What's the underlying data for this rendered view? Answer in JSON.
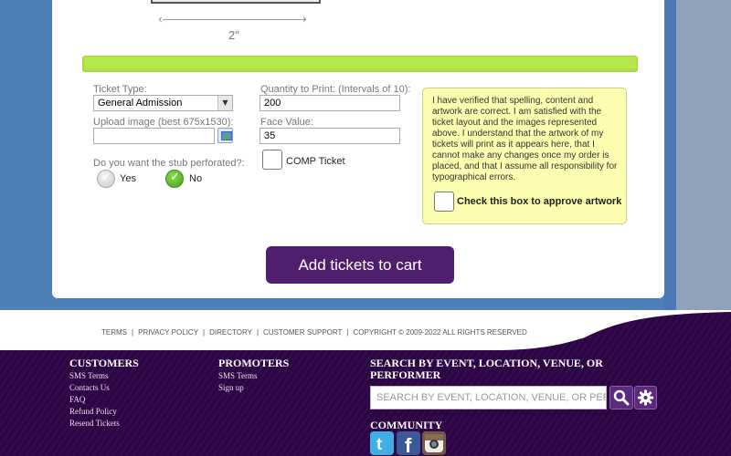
{
  "preview": {
    "width_label": "2\""
  },
  "form": {
    "ticket_type_label": "Ticket Type:",
    "ticket_type_value": "General Admission",
    "quantity_label": "Quantity to Print: (Intervals of 10):",
    "quantity_value": "200",
    "upload_label": "Upload image (best 675x1530):",
    "upload_value": "",
    "face_value_label": "Face Value:",
    "face_value_value": "35",
    "perforated_label": "Do you want the stub perforated?:",
    "perforated_options": [
      {
        "label": "Yes",
        "selected": false
      },
      {
        "label": "No",
        "selected": true
      }
    ],
    "comp_label": "COMP Ticket",
    "comp_checked": false
  },
  "approval": {
    "text": "I have verified that spelling, content and artwork are correct. I am satisfied with the ticket layout and the images represented above. I understand that the artwork of my tickets will print as it appears here, that I cannot make any changes once my order is placed, and that I assume all responsibility for typographical errors.",
    "checkbox_label": "Check this box to approve artwork",
    "checked": false
  },
  "cart_button": "Add tickets to cart",
  "footer": {
    "terms_links": [
      "TERMS",
      "PRIVACY POLICY",
      "DIRECTORY",
      "CUSTOMER SUPPORT"
    ],
    "copyright": "COPYRIGHT © 2009-2022 ALL RIGHTS RESERVED",
    "customers": {
      "heading": "CUSTOMERS",
      "links": [
        "SMS Terms",
        "Contacts Us",
        "FAQ",
        "Refund Policy",
        "Resend Tickets"
      ]
    },
    "promoters": {
      "heading": "PROMOTERS",
      "links": [
        "SMS Terms",
        "Sign up"
      ]
    },
    "search": {
      "heading": "SEARCH BY EVENT, LOCATION, VENUE, OR PERFORMER",
      "placeholder": "SEARCH BY EVENT, LOCATION, VENUE, OR PERFORMER"
    },
    "community": {
      "heading": "COMMUNITY",
      "icons": [
        "twitter-icon",
        "facebook-icon",
        "instagram-icon"
      ]
    }
  },
  "colors": {
    "page_blue": "#4f7fb7",
    "progress_green": "#b5e94a",
    "approve_yellow": "#fdfdb0",
    "brand_purple": "#4f1f6e",
    "footer_purple": "#2b0640"
  }
}
